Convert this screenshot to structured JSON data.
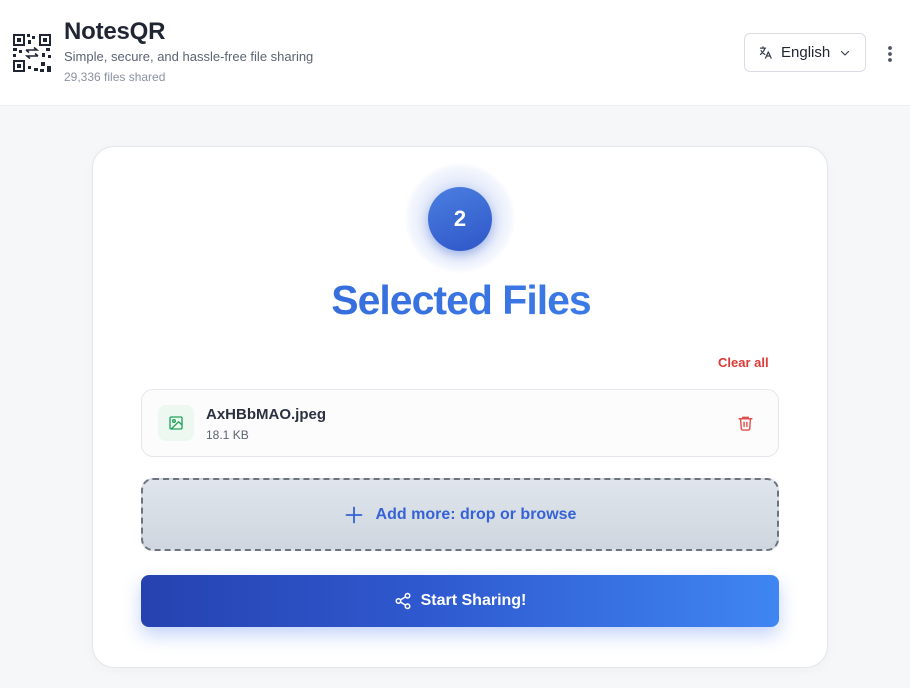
{
  "header": {
    "title": "NotesQR",
    "tagline": "Simple, secure, and hassle-free file sharing",
    "files_shared": "29,336 files shared",
    "language": "English",
    "icons": {
      "logo": "qr-code-logo",
      "language": "translate-icon",
      "chevron": "chevron-down-icon",
      "menu": "more-vertical-icon"
    }
  },
  "selection": {
    "count": "2",
    "heading": "Selected Files",
    "clear_all": "Clear all"
  },
  "files": [
    {
      "name": "AxHBbMAO.jpeg",
      "size": "18.1 KB",
      "icon": "image-file-icon"
    }
  ],
  "dropzone": {
    "label": "Add more: drop or browse",
    "icon": "plus-icon"
  },
  "action": {
    "label": "Start Sharing!",
    "icon": "share-icon"
  },
  "colors": {
    "primary": "#3563d6",
    "danger": "#dc3a36",
    "file_icon": "#21a35a",
    "gradient_start": "#2642b0",
    "gradient_end": "#3f86f2"
  }
}
